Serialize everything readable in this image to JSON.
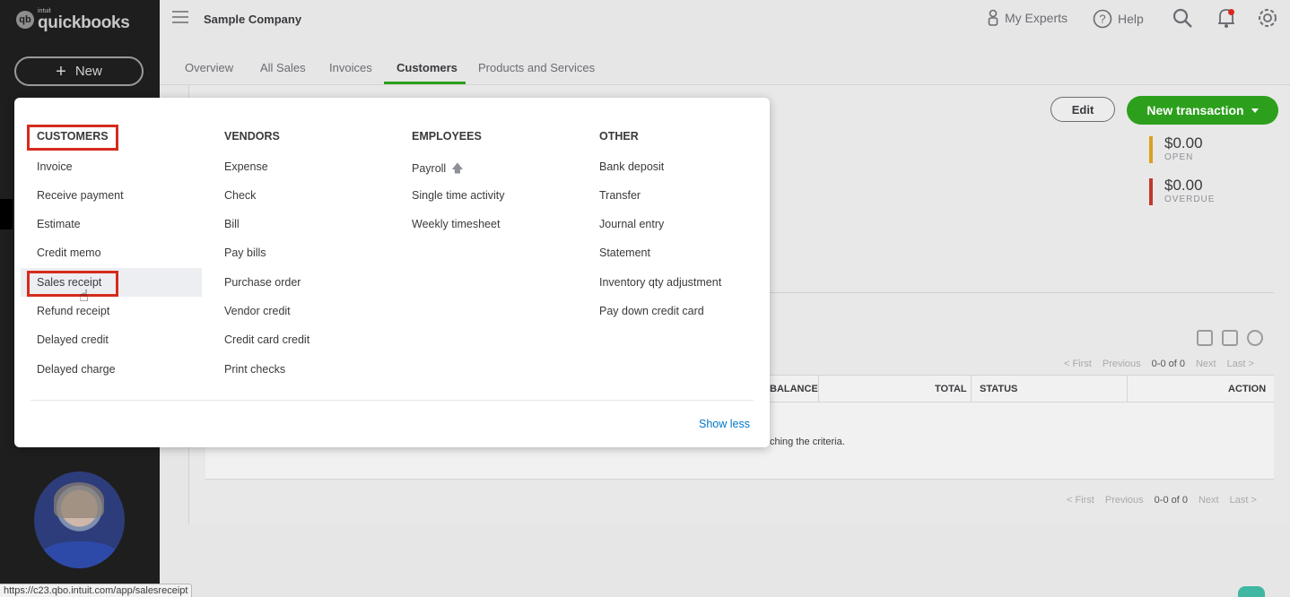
{
  "brand": {
    "logo_mark": "qb",
    "logo_sub": "intuit",
    "logo_main": "quickbooks"
  },
  "sidebar": {
    "new_label": "New"
  },
  "header": {
    "company": "Sample Company",
    "my_experts": "My Experts",
    "help": "Help"
  },
  "tabs": [
    "Overview",
    "All Sales",
    "Invoices",
    "Customers",
    "Products and Services"
  ],
  "actions": {
    "edit": "Edit",
    "new_transaction": "New transaction"
  },
  "stats": [
    {
      "amount": "$0.00",
      "label": "OPEN",
      "color": "#d9a11f"
    },
    {
      "amount": "$0.00",
      "label": "OVERDUE",
      "color": "#c0392b"
    }
  ],
  "pager": {
    "first": "< First",
    "previous": "Previous",
    "range": "0-0 of 0",
    "next": "Next",
    "last": "Last >"
  },
  "table": {
    "columns": [
      "BALANCE",
      "TOTAL",
      "STATUS",
      "ACTION"
    ],
    "empty_text": "ching the criteria."
  },
  "menu": {
    "customers": {
      "heading": "CUSTOMERS",
      "items": [
        "Invoice",
        "Receive payment",
        "Estimate",
        "Credit memo",
        "Sales receipt",
        "Refund receipt",
        "Delayed credit",
        "Delayed charge"
      ]
    },
    "vendors": {
      "heading": "VENDORS",
      "items": [
        "Expense",
        "Check",
        "Bill",
        "Pay bills",
        "Purchase order",
        "Vendor credit",
        "Credit card credit",
        "Print checks"
      ]
    },
    "employees": {
      "heading": "EMPLOYEES",
      "items": [
        "Payroll",
        "Single time activity",
        "Weekly timesheet"
      ]
    },
    "other": {
      "heading": "OTHER",
      "items": [
        "Bank deposit",
        "Transfer",
        "Journal entry",
        "Statement",
        "Inventory qty adjustment",
        "Pay down credit card"
      ]
    },
    "show_less": "Show less"
  },
  "status_url": "https://c23.qbo.intuit.com/app/salesreceipt",
  "colors": {
    "accent_green": "#2ca01c",
    "highlight_red": "#d52b1e",
    "link_blue": "#0077c5"
  }
}
